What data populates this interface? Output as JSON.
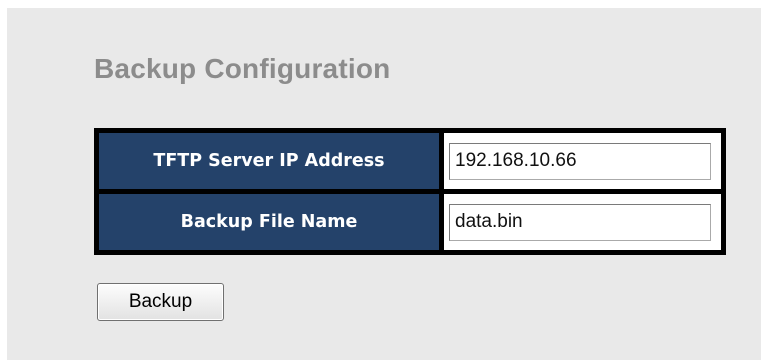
{
  "page": {
    "title": "Backup Configuration"
  },
  "form": {
    "fields": [
      {
        "label": "TFTP Server IP Address",
        "value": "192.168.10.66"
      },
      {
        "label": "Backup File Name",
        "value": "data.bin"
      }
    ]
  },
  "actions": {
    "backup_label": "Backup"
  },
  "colors": {
    "page_background": "#e9e9e9",
    "label_cell_background": "#24426a",
    "table_border": "#000000",
    "title_text": "#8c8c8c"
  }
}
